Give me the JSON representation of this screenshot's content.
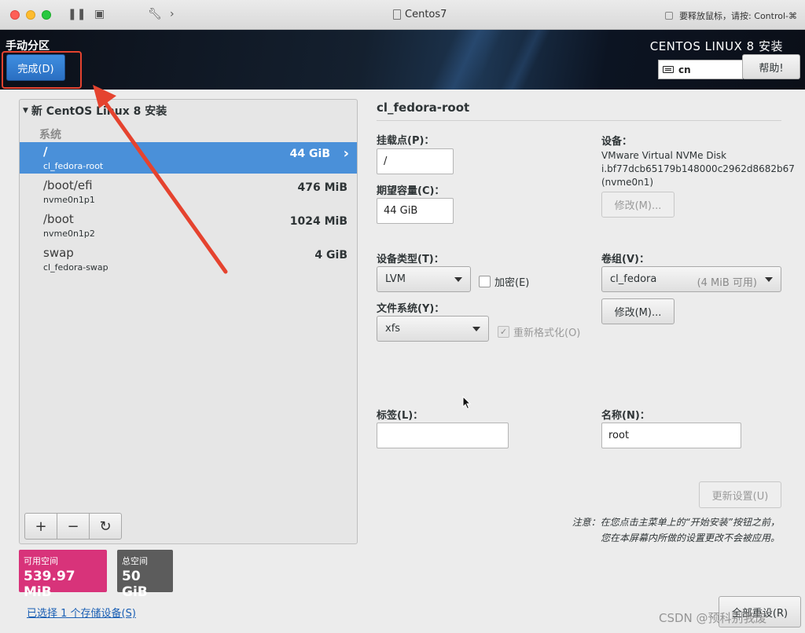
{
  "window": {
    "title": "Centos7",
    "release_hint": "要释放鼠标，请按: Control-⌘"
  },
  "header": {
    "page_title": "手动分区",
    "done_button": "完成(D)",
    "product": "CENTOS LINUX 8 安装",
    "keyboard_layout": "cn",
    "help_button": "帮助!"
  },
  "left": {
    "group_title": "新 CentOS Linux 8 安装",
    "section": "系统",
    "partitions": [
      {
        "mount": "/",
        "device": "cl_fedora-root",
        "size": "44 GiB"
      },
      {
        "mount": "/boot/efi",
        "device": "nvme0n1p1",
        "size": "476 MiB"
      },
      {
        "mount": "/boot",
        "device": "nvme0n1p2",
        "size": "1024 MiB"
      },
      {
        "mount": "swap",
        "device": "cl_fedora-swap",
        "size": "4 GiB"
      }
    ],
    "tools": {
      "add": "+",
      "remove": "−",
      "refresh": "↻"
    },
    "available_label": "可用空间",
    "available_value": "539.97 MiB",
    "total_label": "总空间",
    "total_value": "50 GiB",
    "storage_link": "已选择 1 个存储设备(S)"
  },
  "detail": {
    "title": "cl_fedora-root",
    "mount_label": "挂载点(P)：",
    "mount_value": "/",
    "capacity_label": "期望容量(C)：",
    "capacity_value": "44 GiB",
    "device_label": "设备：",
    "device_text": "VMware Virtual NVMe Disk i.bf77dcb65179b148000c2962d8682b67 (nvme0n1)",
    "modify_device_button": "修改(M)...",
    "device_type_label": "设备类型(T)：",
    "device_type_value": "LVM",
    "encrypt_label": "加密(E)",
    "volume_group_label": "卷组(V)：",
    "volume_group_value": "cl_fedora",
    "volume_group_free": "(4 MiB 可用)",
    "modify_vg_button": "修改(M)...",
    "filesystem_label": "文件系统(Y)：",
    "filesystem_value": "xfs",
    "reformat_label": "重新格式化(O)",
    "tag_label": "标签(L)：",
    "tag_value": "",
    "name_label": "名称(N)：",
    "name_value": "root",
    "update_button": "更新设置(U)",
    "note_line1": "注意：在您点击主菜单上的“开始安装”按钮之前，",
    "note_line2": "您在本屏幕内所做的设置更改不会被应用。",
    "reset_all_button": "全部重设(R)"
  },
  "watermark": "CSDN @预科别我废",
  "colors": {
    "selection": "#4a90d9",
    "available": "#d8337a",
    "total": "#5c5c5c",
    "done_button": "#2a6fc2",
    "annotation": "#e5432f"
  }
}
